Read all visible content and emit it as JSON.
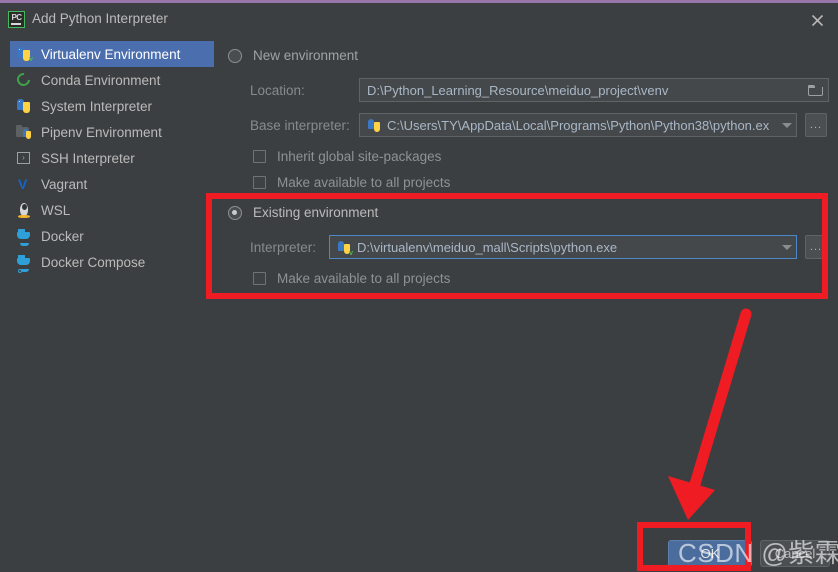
{
  "window": {
    "title": "Add Python Interpreter",
    "app_icon": "pycharm-icon",
    "close_icon": "close-icon",
    "accent_color": "#9876aa",
    "background_color": "#3c3f41"
  },
  "sidebar": {
    "items": [
      {
        "label": "Virtualenv Environment",
        "icon": "python-virtualenv-icon",
        "selected": true
      },
      {
        "label": "Conda Environment",
        "icon": "conda-icon",
        "selected": false
      },
      {
        "label": "System Interpreter",
        "icon": "python-icon",
        "selected": false
      },
      {
        "label": "Pipenv Environment",
        "icon": "pipenv-folder-icon",
        "selected": false
      },
      {
        "label": "SSH Interpreter",
        "icon": "ssh-terminal-icon",
        "selected": false
      },
      {
        "label": "Vagrant",
        "icon": "vagrant-icon",
        "selected": false
      },
      {
        "label": "WSL",
        "icon": "wsl-penguin-icon",
        "selected": false
      },
      {
        "label": "Docker",
        "icon": "docker-whale-icon",
        "selected": false
      },
      {
        "label": "Docker Compose",
        "icon": "docker-compose-icon",
        "selected": false
      }
    ]
  },
  "main": {
    "new_environment": {
      "radio_label": "New environment",
      "selected": false,
      "location": {
        "label": "Location:",
        "value": "D:\\Python_Learning_Resource\\meiduo_project\\venv",
        "browse_icon": "folder-icon"
      },
      "base_interpreter": {
        "label": "Base interpreter:",
        "value": "C:\\Users\\TY\\AppData\\Local\\Programs\\Python\\Python38\\python.ex",
        "icon": "python-icon",
        "dropdown_icon": "chevron-down-icon",
        "more_button": "..."
      },
      "inherit_checkbox": {
        "label": "Inherit global site-packages",
        "checked": false
      },
      "make_available_checkbox": {
        "label": "Make available to all projects",
        "checked": false
      }
    },
    "existing_environment": {
      "radio_label": "Existing environment",
      "selected": true,
      "interpreter": {
        "label": "Interpreter:",
        "value": "D:\\virtualenv\\meiduo_mall\\Scripts\\python.exe",
        "icon": "python-virtualenv-icon",
        "dropdown_icon": "chevron-down-icon",
        "more_button": "..."
      },
      "make_available_checkbox": {
        "label": "Make available to all projects",
        "checked": false
      }
    }
  },
  "footer": {
    "ok_label": "OK",
    "cancel_label": "Cancel"
  },
  "annotations": {
    "highlight_color": "#f01c23",
    "arrow_icon": "red-arrow-down-icon",
    "watermark_text": "CSDN @紫霖ty"
  }
}
